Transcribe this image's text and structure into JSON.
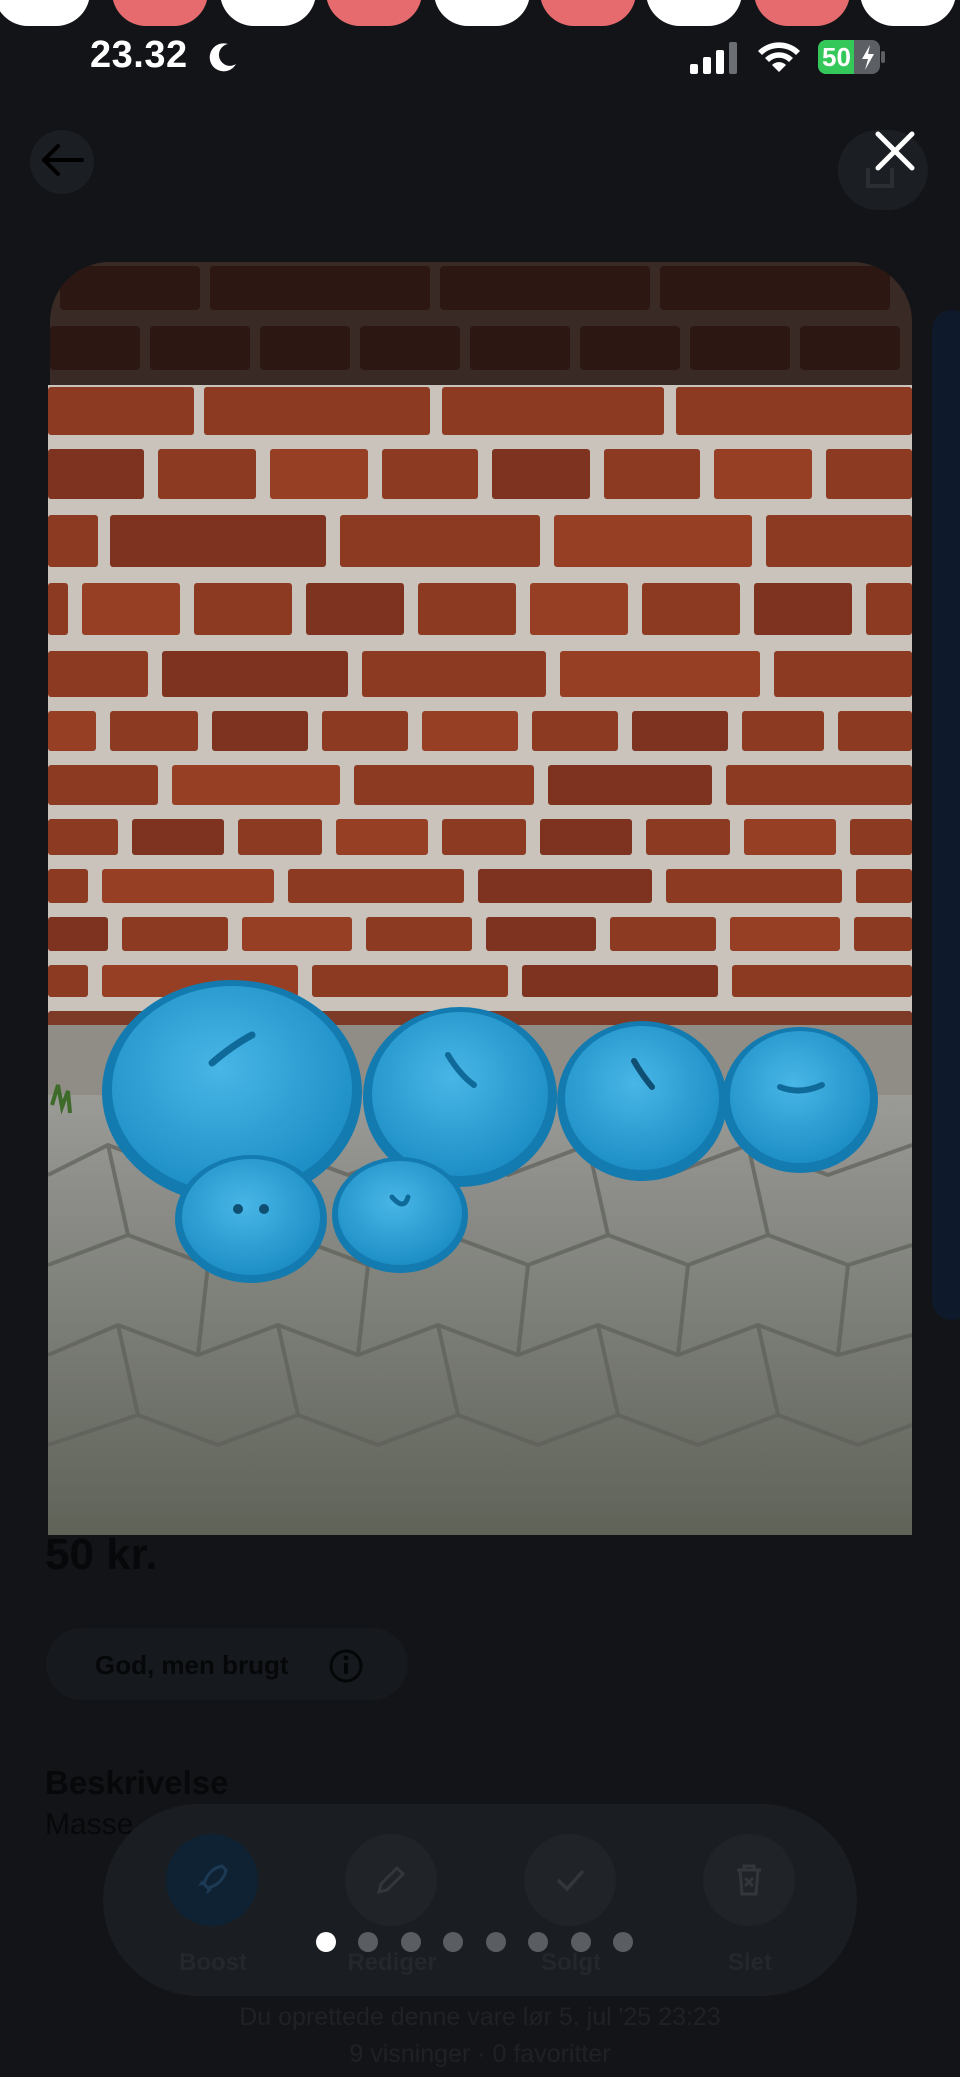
{
  "status_bar": {
    "time": "23.32",
    "battery_percent": "50"
  },
  "listing": {
    "price": "50 kr.",
    "condition": "God, men brugt",
    "description_title": "Beskrivelse",
    "description_preview": "Masse",
    "created_text": "Du oprettede denne vare lør 5. jul '25 23:23",
    "stats_text": "9 visninger · 0 favoritter"
  },
  "actions": [
    {
      "label": "Boost",
      "icon": "rocket-icon"
    },
    {
      "label": "Rediger",
      "icon": "pencil-icon"
    },
    {
      "label": "Solgt",
      "icon": "checkmark-icon"
    },
    {
      "label": "Slet",
      "icon": "trash-icon"
    }
  ],
  "viewer": {
    "photo_count": 8,
    "current_index": 1
  },
  "colors": {
    "accent_dot": "#ffffff",
    "inactive_dot": "#5a5d62",
    "battery_green": "#34c759",
    "lid_blue": "#2aa3d6",
    "brick": "#8c3a22"
  }
}
